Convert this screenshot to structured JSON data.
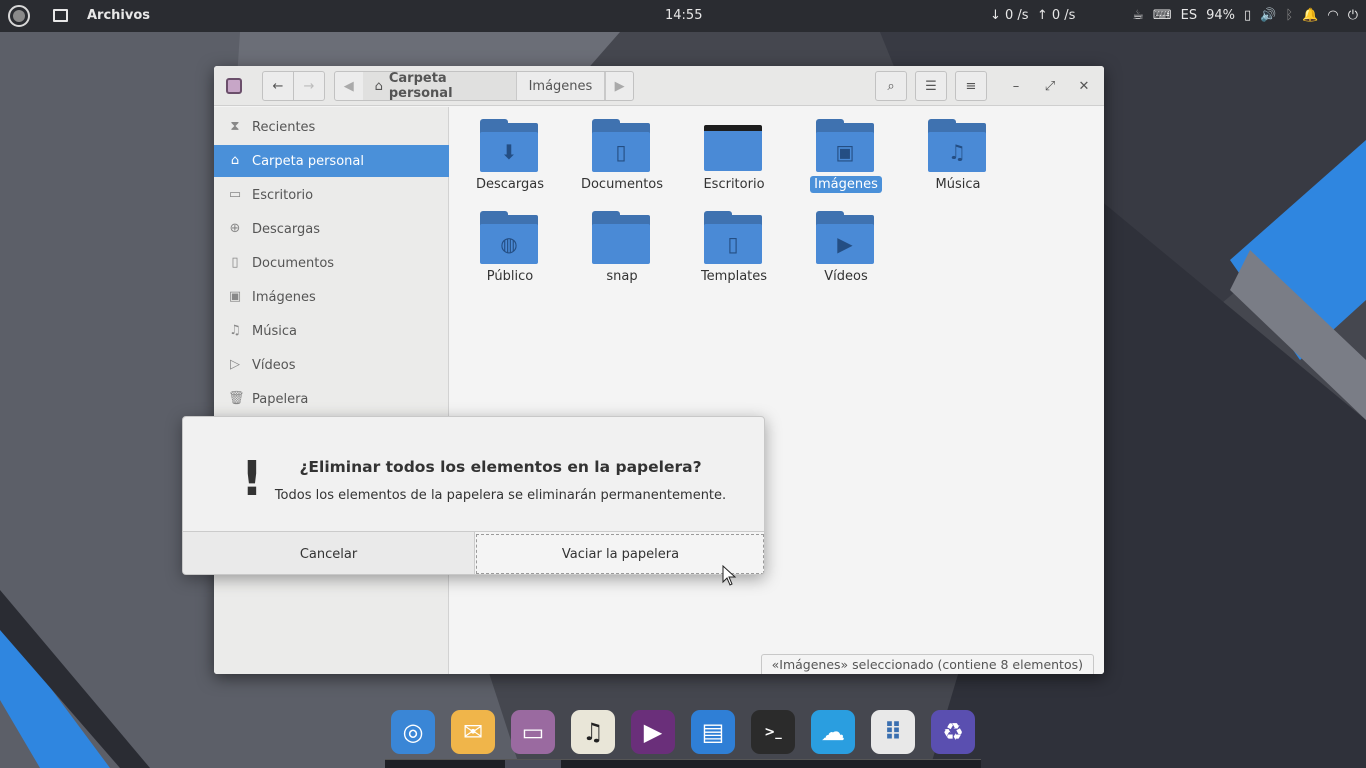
{
  "top_panel": {
    "app_name": "Archivos",
    "clock": "14:55",
    "net_down": "↓  0 /s",
    "net_up": "↑  0 /s",
    "keyboard_layout": "ES",
    "battery_percent": "94%"
  },
  "window": {
    "breadcrumb": {
      "home_label": "Carpeta personal",
      "current_label": "Imágenes"
    }
  },
  "sidebar": {
    "items": [
      {
        "label": "Recientes",
        "icon": "clock-icon"
      },
      {
        "label": "Carpeta personal",
        "icon": "home-icon"
      },
      {
        "label": "Escritorio",
        "icon": "desktop-icon"
      },
      {
        "label": "Descargas",
        "icon": "download-icon"
      },
      {
        "label": "Documentos",
        "icon": "document-icon"
      },
      {
        "label": "Imágenes",
        "icon": "image-icon"
      },
      {
        "label": "Música",
        "icon": "music-icon"
      },
      {
        "label": "Vídeos",
        "icon": "video-icon"
      },
      {
        "label": "Papelera",
        "icon": "trash-icon"
      }
    ],
    "selected_index": 1
  },
  "folders": [
    {
      "label": "Descargas",
      "glyph": "⬇"
    },
    {
      "label": "Documentos",
      "glyph": "▯"
    },
    {
      "label": "Escritorio",
      "glyph": ""
    },
    {
      "label": "Imágenes",
      "glyph": "▣"
    },
    {
      "label": "Música",
      "glyph": "♫"
    },
    {
      "label": "Público",
      "glyph": "◍"
    },
    {
      "label": "snap",
      "glyph": ""
    },
    {
      "label": "Templates",
      "glyph": "▯"
    },
    {
      "label": "Vídeos",
      "glyph": "▶"
    }
  ],
  "selected_folder_index": 3,
  "statusbar": {
    "text": "«Imágenes» seleccionado  (contiene 8 elementos)"
  },
  "dialog": {
    "title": "¿Eliminar todos los elementos en la papelera?",
    "message": "Todos los elementos de la papelera se eliminarán permanentemente.",
    "cancel_label": "Cancelar",
    "confirm_label": "Vaciar la papelera"
  },
  "dock": {
    "apps": [
      {
        "name": "chrome-icon",
        "bg": "#3a86d6"
      },
      {
        "name": "mail-icon",
        "bg": "#f0b54a"
      },
      {
        "name": "files-icon",
        "bg": "#9a6aa0"
      },
      {
        "name": "music-app-icon",
        "bg": "#e9e6d8"
      },
      {
        "name": "video-app-icon",
        "bg": "#6a2f7a"
      },
      {
        "name": "writer-icon",
        "bg": "#2f7fd6"
      },
      {
        "name": "terminal-icon",
        "bg": "#2b2b2b"
      },
      {
        "name": "weather-icon",
        "bg": "#2a9ee0"
      },
      {
        "name": "app-grid-icon",
        "bg": "#e8e8e8"
      },
      {
        "name": "trash-recycle-icon",
        "bg": "#5a4fb0"
      }
    ]
  }
}
